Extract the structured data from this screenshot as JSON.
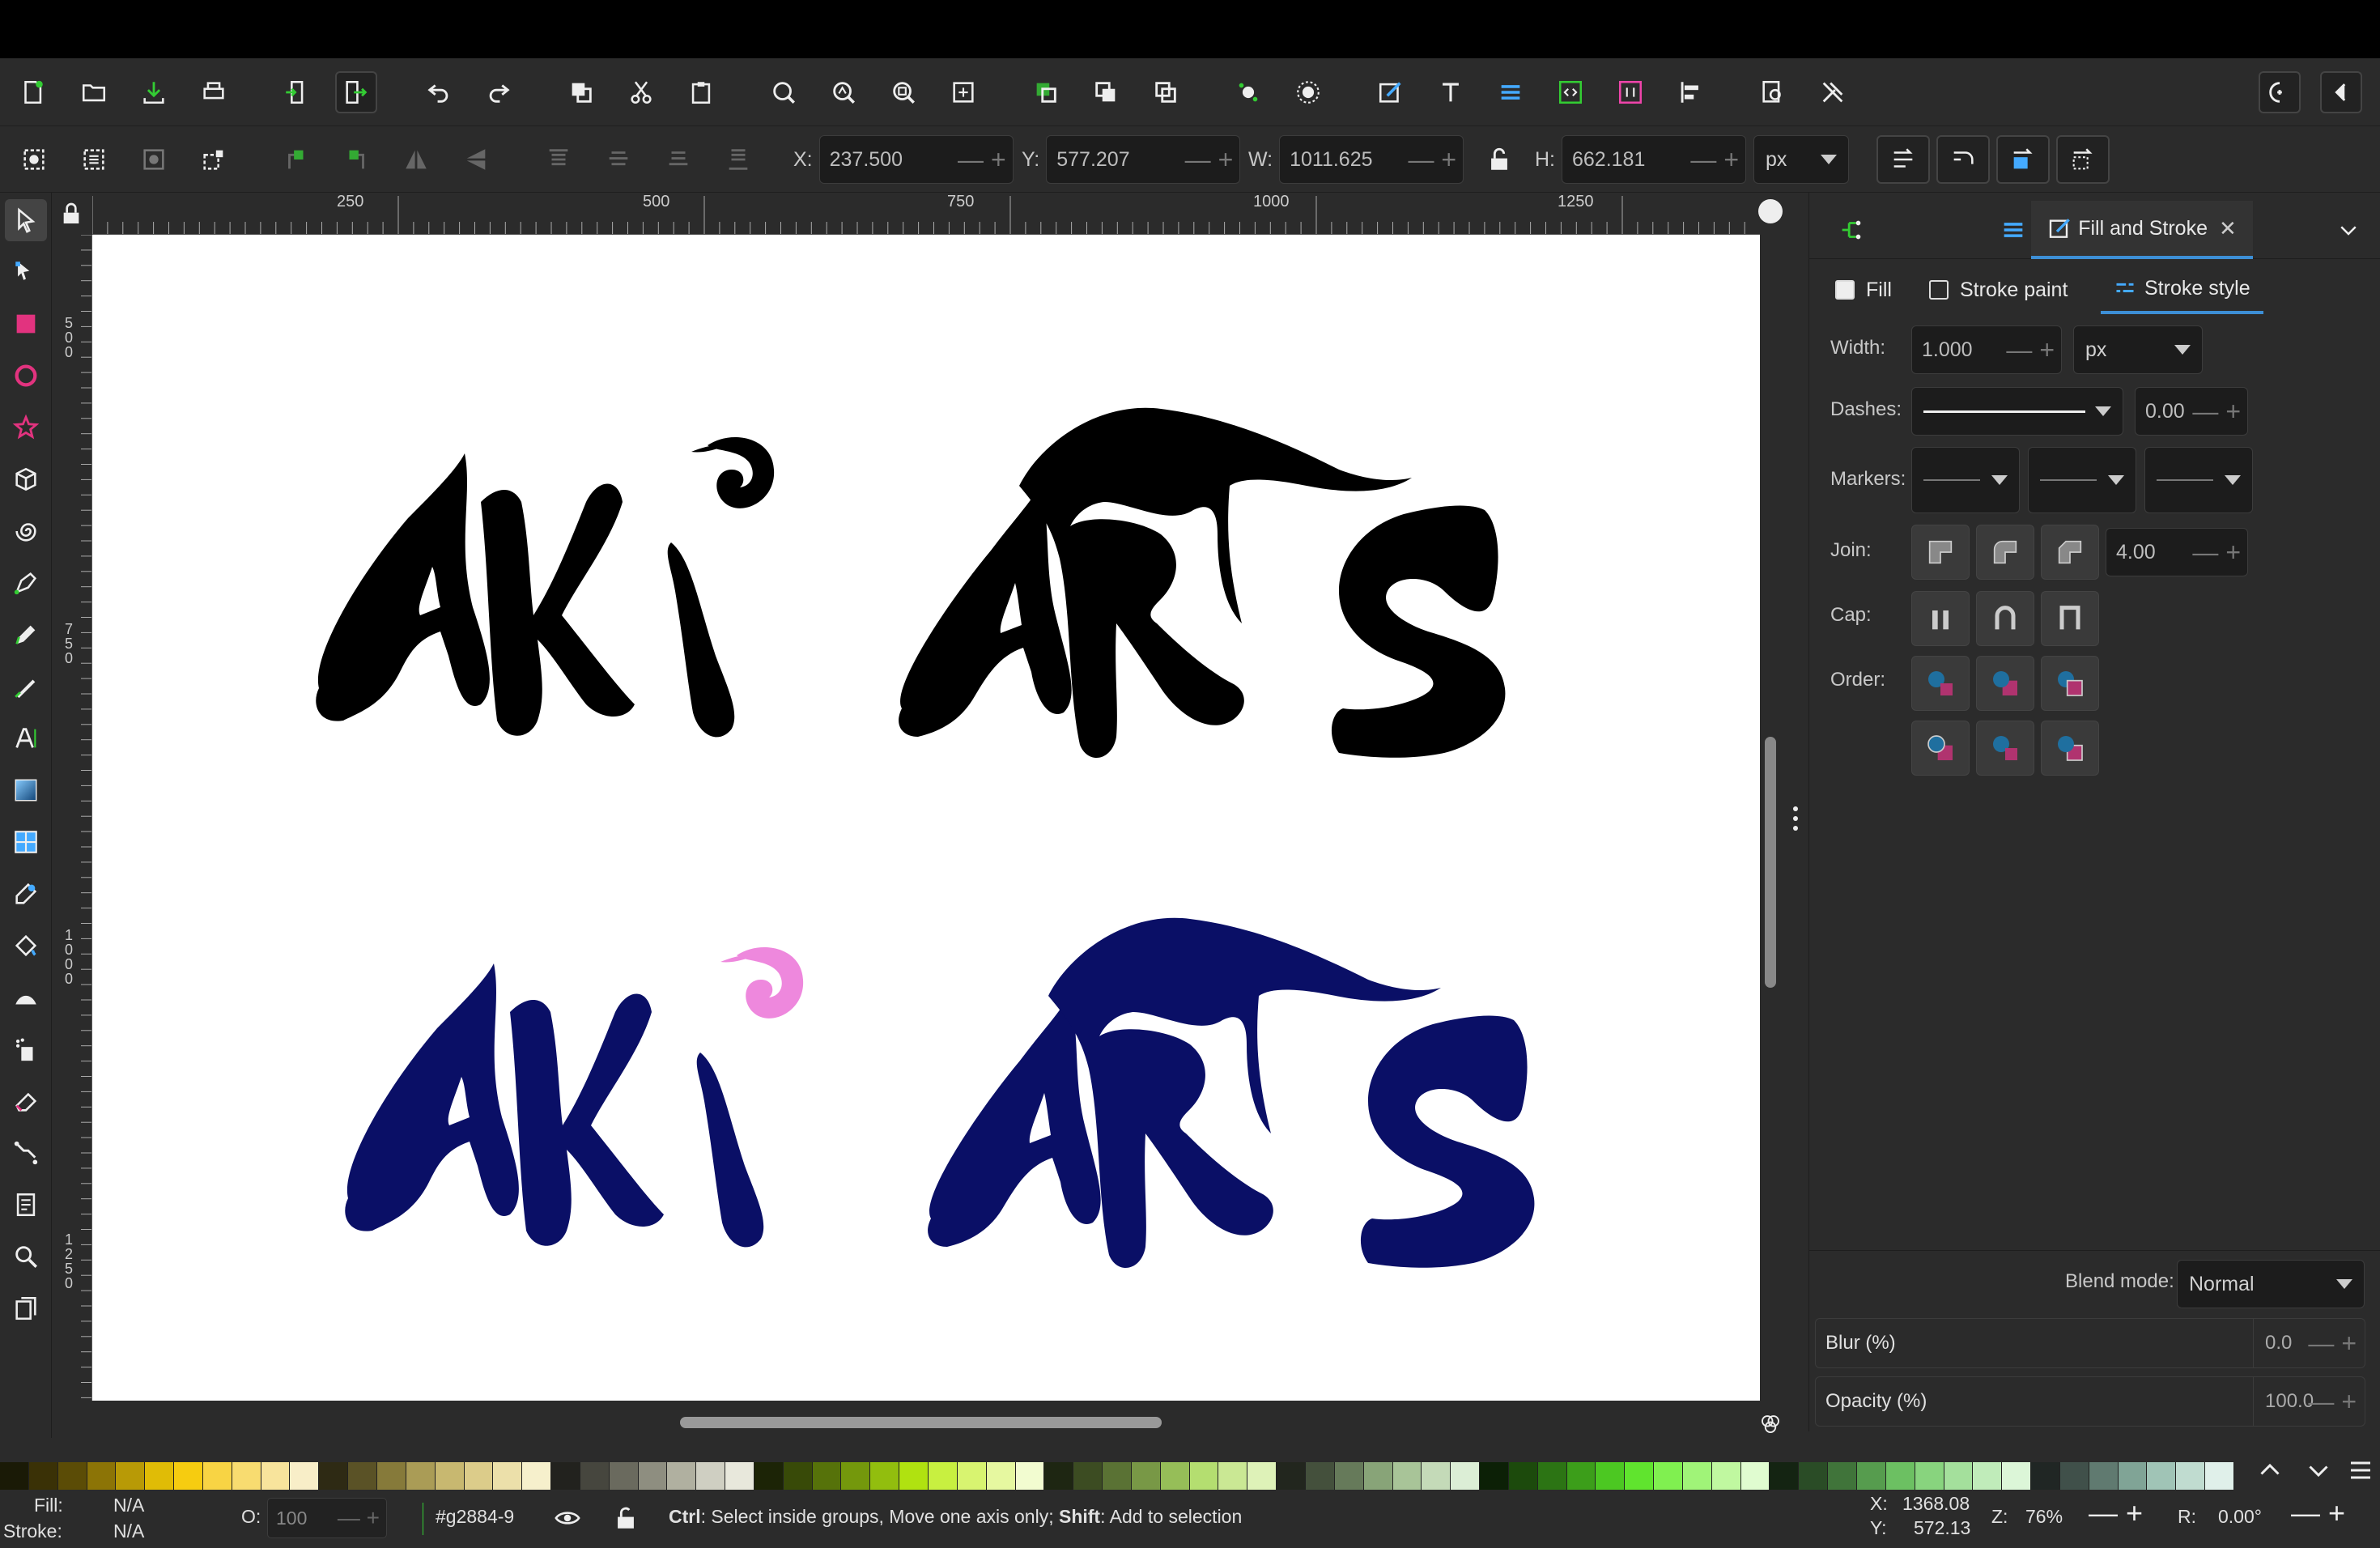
{
  "commands": {
    "icons": [
      "new-document-icon",
      "open-folder-icon",
      "save-icon",
      "print-icon",
      "import-icon",
      "export-icon",
      "undo-icon",
      "redo-icon",
      "duplicate-icon",
      "cut-icon",
      "paste-icon",
      "zoom-selection-icon",
      "zoom-drawing-icon",
      "zoom-page-icon",
      "zoom-fit-icon",
      "group-icon",
      "ungroup-icon",
      "clone-icon",
      "node-icon",
      "snap-icon",
      "fill-stroke-icon",
      "text-icon",
      "layers-icon",
      "xml-editor-icon",
      "objects-icon",
      "align-icon",
      "find-icon",
      "preferences-icon",
      "snap-toggle-icon",
      "collapse-icon"
    ]
  },
  "toolctrl": {
    "x_label": "X:",
    "x_value": "237.500",
    "y_label": "Y:",
    "y_value": "577.207",
    "w_label": "W:",
    "w_value": "1011.625",
    "h_label": "H:",
    "h_value": "662.181",
    "unit": "px"
  },
  "ruler": {
    "top_labels": [
      "250",
      "500",
      "750",
      "1000",
      "1250"
    ],
    "left_labels": [
      "500",
      "750",
      "1000",
      "1250"
    ]
  },
  "artwork": {
    "top_text": "AKi ARTS",
    "bottom_text": "AKi ARTS",
    "top_color": "#000000",
    "bottom_color": "#0a0f66",
    "swirl_top_color": "#000000",
    "swirl_bottom_color": "#ee88dd"
  },
  "panel": {
    "tab_title": "Fill and Stroke",
    "subtabs": {
      "fill": "Fill",
      "stroke_paint": "Stroke paint",
      "stroke_style": "Stroke style"
    },
    "width_label": "Width:",
    "width_value": "1.000",
    "width_unit": "px",
    "dashes_label": "Dashes:",
    "dashes_value": "0.00",
    "markers_label": "Markers:",
    "join_label": "Join:",
    "join_value": "4.00",
    "cap_label": "Cap:",
    "order_label": "Order:",
    "blend_label": "Blend mode:",
    "blend_value": "Normal",
    "blur_label": "Blur (%)",
    "blur_value": "0.0",
    "opacity_label": "Opacity (%)",
    "opacity_value": "100.0"
  },
  "palette": [
    "#1a1a06",
    "#3a3106",
    "#5b4c06",
    "#8c7406",
    "#b89a06",
    "#e0bc06",
    "#f6cc10",
    "#f8d444",
    "#f8dc70",
    "#f8e49c",
    "#f8eec8",
    "#2e2a14",
    "#5a5226",
    "#867a3a",
    "#aa9c56",
    "#c8b870",
    "#dccc8a",
    "#ece0aa",
    "#f6f0cc",
    "#22221e",
    "#46463e",
    "#6a6a5e",
    "#8e8e80",
    "#b0b0a0",
    "#cfcfc2",
    "#e8e8dc",
    "#1c2406",
    "#384a08",
    "#56720a",
    "#74980c",
    "#92be0e",
    "#b0e210",
    "#c8f040",
    "#d8f470",
    "#e6f8a0",
    "#f2fcd0",
    "#1e2612",
    "#3c4c22",
    "#5a7234",
    "#789846",
    "#96be58",
    "#b4de70",
    "#cae894",
    "#def2b8",
    "#22261e",
    "#44503c",
    "#667a5a",
    "#88a478",
    "#a8c498",
    "#c4dab8",
    "#dceed6",
    "#0c2006",
    "#1c4a0c",
    "#2c7414",
    "#3c9e1a",
    "#4cc822",
    "#60e42e",
    "#80f050",
    "#a0f478",
    "#c0f8a0",
    "#e0fcd0",
    "#142412",
    "#2a4c26",
    "#40743a",
    "#569c4e",
    "#6cc062",
    "#88d47e",
    "#a4e09c",
    "#c0ecba",
    "#dcf6d8",
    "#202624",
    "#40504a",
    "#607a70",
    "#80a496",
    "#a0c4b6",
    "#c0dcd0",
    "#e0f0ea"
  ],
  "status": {
    "fill_label": "Fill:",
    "fill_value": "N/A",
    "stroke_label": "Stroke:",
    "stroke_value": "N/A",
    "o_label": "O:",
    "o_value": "100",
    "layer": "#g2884-9",
    "message_ctrl": "Ctrl",
    "message_a": ": Select inside groups, Move one axis only; ",
    "message_shift": "Shift",
    "message_b": ": Add to selection",
    "cx_label": "X:",
    "cx_value": "1368.08",
    "cy_label": "Y:",
    "cy_value": "572.13",
    "z_label": "Z:",
    "zoom": "76%",
    "r_label": "R:",
    "rotation": "0.00°"
  }
}
